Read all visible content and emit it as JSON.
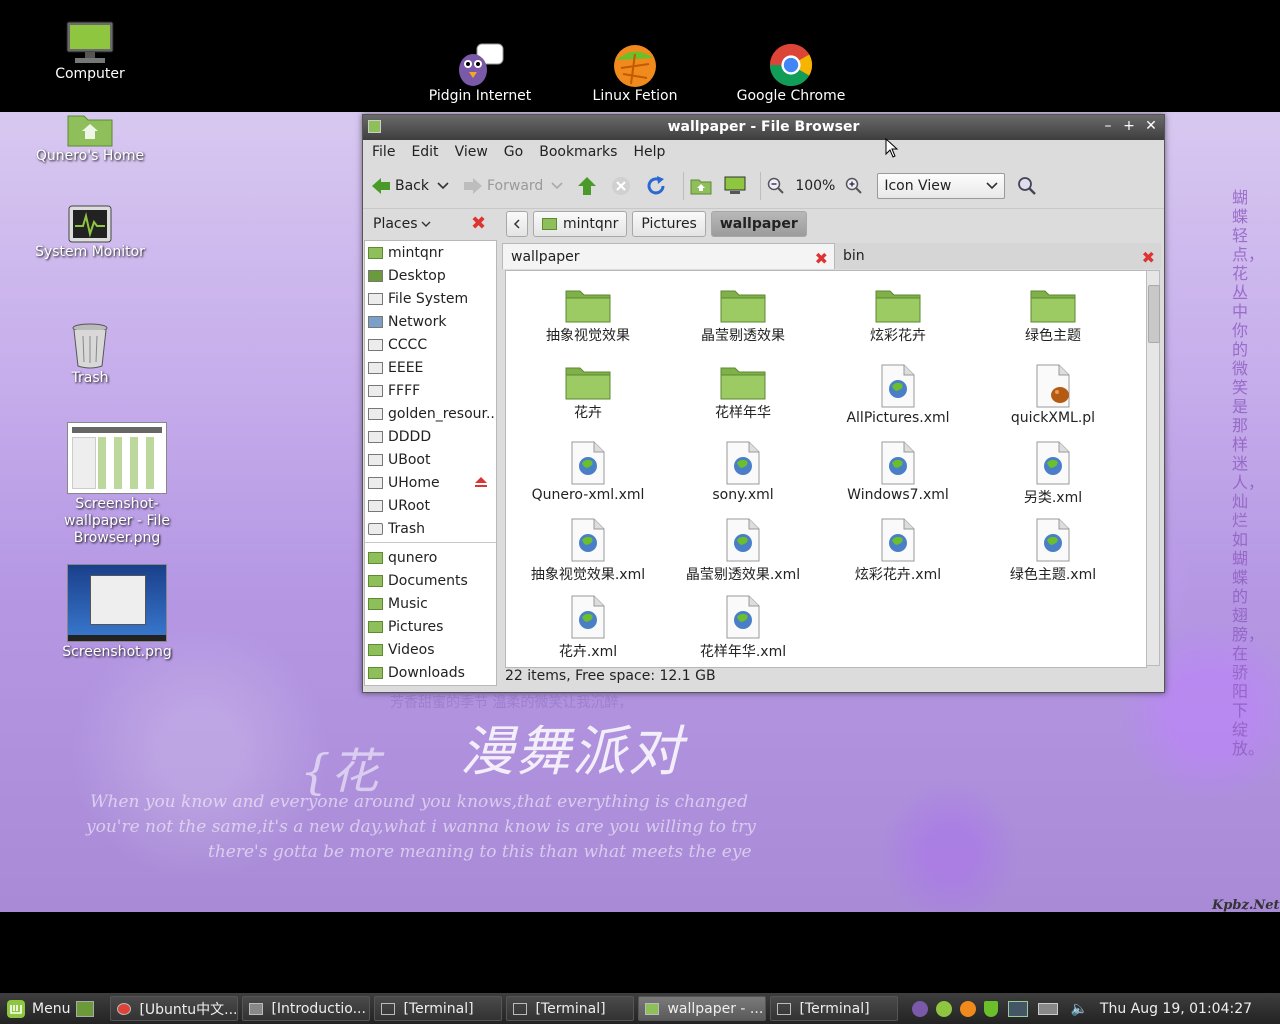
{
  "desktop": {
    "icons": [
      {
        "label": "Computer"
      },
      {
        "label": "Qunero's Home"
      },
      {
        "label": "System Monitor"
      },
      {
        "label": "Trash"
      },
      {
        "label": "Screenshot-wallpaper - File Browser.png"
      },
      {
        "label": "Screenshot.png"
      }
    ],
    "top_icons": [
      {
        "label": "Pidgin Internet Messenger"
      },
      {
        "label": "Linux Fetion"
      },
      {
        "label": "Google Chrome"
      }
    ]
  },
  "wallpaper": {
    "title": "漫舞派对",
    "subtitle": "芳香甜蜜的季节 温柔的微笑让我沉醉，",
    "line1": "When you know and everyone around you knows,that everything is changed",
    "line2": "you're not the same,it's a new day,what i wanna know is are you willing to try",
    "line3": "there's gotta be more meaning to this than what meets the eye",
    "vertical": "蝴蝶轻点，花丛中你的微笑是那样迷人，灿烂如蝴蝶的翅膀，在骄阳下绽放。",
    "brand": "Kpbz.Net",
    "brace": "{花"
  },
  "window": {
    "title": "wallpaper - File Browser",
    "menu": [
      "File",
      "Edit",
      "View",
      "Go",
      "Bookmarks",
      "Help"
    ],
    "toolbar": {
      "back": "Back",
      "forward": "Forward",
      "zoom": "100%",
      "view_mode": "Icon View"
    },
    "places_label": "Places",
    "places": [
      "mintqnr",
      "Desktop",
      "File System",
      "Network",
      "CCCC",
      "EEEE",
      "FFFF",
      "golden_resour...",
      "DDDD",
      "UBoot",
      "UHome",
      "URoot",
      "Trash"
    ],
    "bookmarks": [
      "qunero",
      "Documents",
      "Music",
      "Pictures",
      "Videos",
      "Downloads"
    ],
    "path": [
      "mintqnr",
      "Pictures",
      "wallpaper"
    ],
    "tabs": [
      "wallpaper",
      "bin"
    ],
    "files": [
      {
        "name": "抽象视觉效果",
        "type": "folder"
      },
      {
        "name": "晶莹剔透效果",
        "type": "folder"
      },
      {
        "name": "炫彩花卉",
        "type": "folder"
      },
      {
        "name": "绿色主题",
        "type": "folder"
      },
      {
        "name": "花卉",
        "type": "folder"
      },
      {
        "name": "花样年华",
        "type": "folder"
      },
      {
        "name": "AllPictures.xml",
        "type": "xml"
      },
      {
        "name": "quickXML.pl",
        "type": "perl"
      },
      {
        "name": "Qunero-xml.xml",
        "type": "xml"
      },
      {
        "name": "sony.xml",
        "type": "xml"
      },
      {
        "name": "Windows7.xml",
        "type": "xml"
      },
      {
        "name": "另类.xml",
        "type": "xml"
      },
      {
        "name": "抽象视觉效果.xml",
        "type": "xml"
      },
      {
        "name": "晶莹剔透效果.xml",
        "type": "xml"
      },
      {
        "name": "炫彩花卉.xml",
        "type": "xml"
      },
      {
        "name": "绿色主题.xml",
        "type": "xml"
      },
      {
        "name": "花卉.xml",
        "type": "xml"
      },
      {
        "name": "花样年华.xml",
        "type": "xml"
      }
    ],
    "status": "22 items, Free space: 12.1 GB"
  },
  "taskbar": {
    "menu_label": "Menu",
    "tasks": [
      {
        "label": "[Ubuntu中文..."
      },
      {
        "label": "[Introductio..."
      },
      {
        "label": "[Terminal]"
      },
      {
        "label": "[Terminal]"
      },
      {
        "label": "wallpaper - ..."
      },
      {
        "label": "[Terminal]"
      }
    ],
    "clock": "Thu Aug 19, 01:04:27"
  },
  "colors": {
    "folder": "#8fbf5a",
    "accent_green": "#4a9a2a",
    "close_red": "#d33333"
  }
}
